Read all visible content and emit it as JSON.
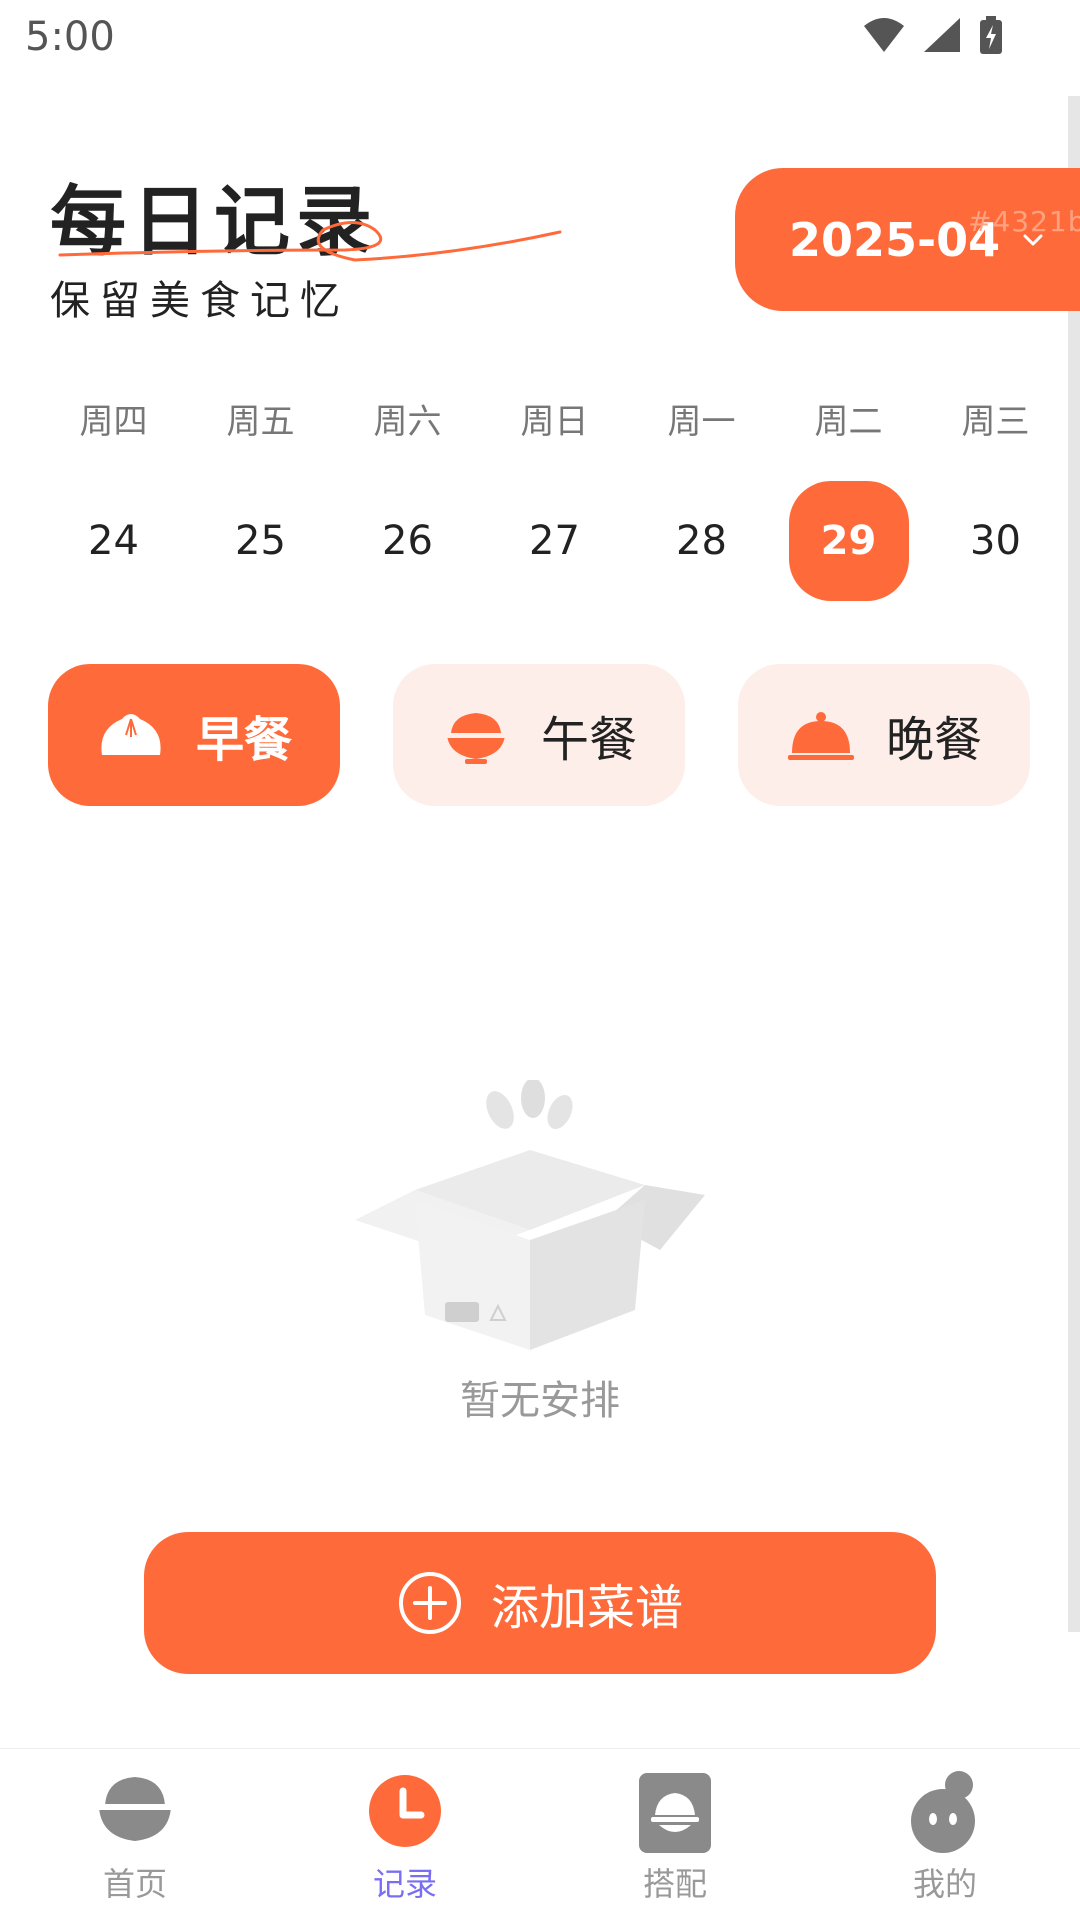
{
  "status_bar": {
    "time": "5:00",
    "icons": [
      "wifi-icon",
      "signal-icon",
      "battery-charging-icon"
    ]
  },
  "header": {
    "title": "每日记录",
    "subtitle": "保留美食记忆",
    "month": "2025-04",
    "watermark": "#4321b"
  },
  "week": {
    "days": [
      {
        "weekday": "周四",
        "date": "24"
      },
      {
        "weekday": "周五",
        "date": "25"
      },
      {
        "weekday": "周六",
        "date": "26"
      },
      {
        "weekday": "周日",
        "date": "27"
      },
      {
        "weekday": "周一",
        "date": "28"
      },
      {
        "weekday": "周二",
        "date": "29",
        "selected": true
      },
      {
        "weekday": "周三",
        "date": "30"
      }
    ]
  },
  "meals": [
    {
      "label": "早餐",
      "icon": "bun-icon",
      "active": true
    },
    {
      "label": "午餐",
      "icon": "rice-bowl-icon",
      "active": false
    },
    {
      "label": "晚餐",
      "icon": "cloche-icon",
      "active": false
    }
  ],
  "empty_state": {
    "text": "暂无安排",
    "icon": "empty-box-icon"
  },
  "add_button": {
    "label": "添加菜谱",
    "icon": "plus-circle-icon"
  },
  "nav": [
    {
      "label": "首页",
      "icon": "rice-bowl-nav-icon",
      "active": false
    },
    {
      "label": "记录",
      "icon": "clock-icon",
      "active": true
    },
    {
      "label": "搭配",
      "icon": "plate-icon",
      "active": false
    },
    {
      "label": "我的",
      "icon": "profile-icon",
      "active": false
    }
  ],
  "colors": {
    "accent": "#ff6a3a",
    "accent_light": "#fdeee9",
    "nav_active": "#7a6ff2"
  }
}
